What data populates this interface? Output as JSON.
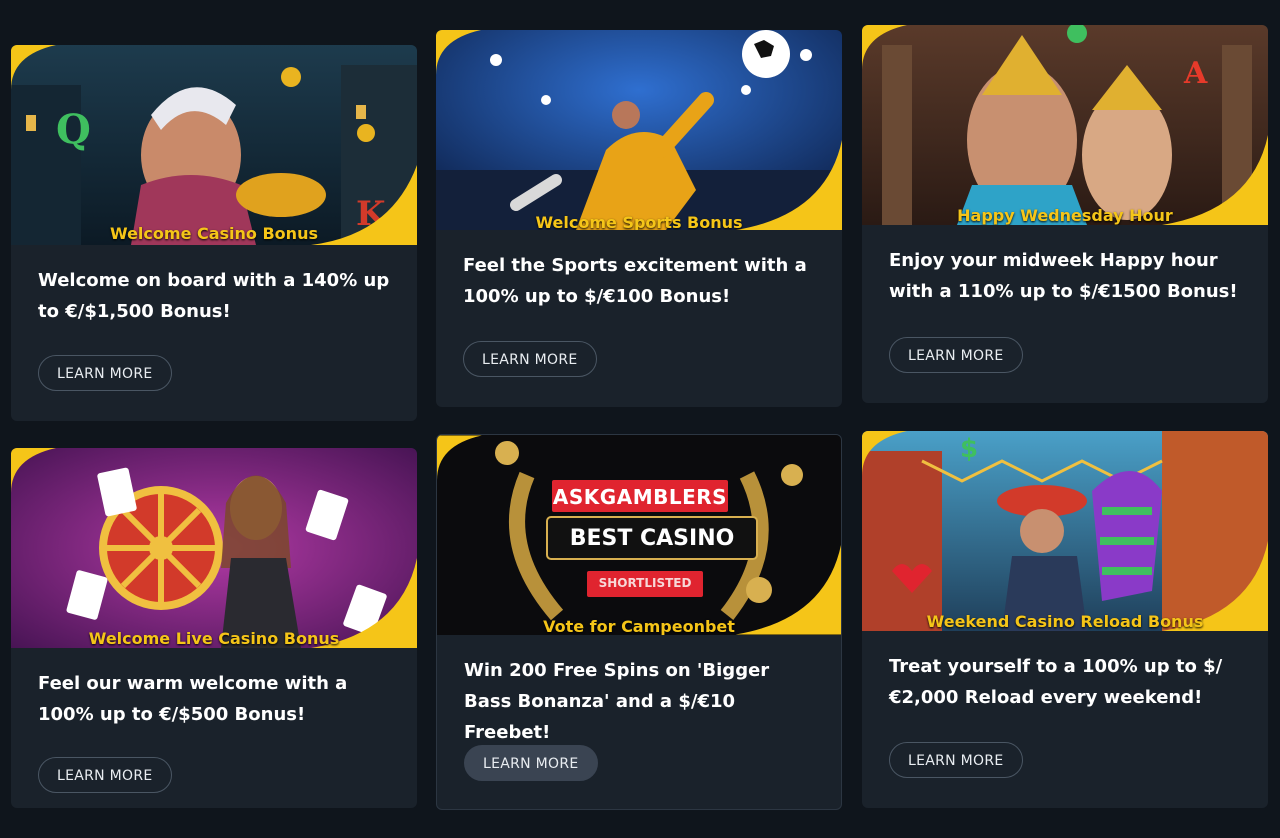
{
  "colors": {
    "page_bg": "#0f151c",
    "card_bg": "#1a222b",
    "accent": "#f5c518",
    "button_border": "#4a5663",
    "button_active_bg": "#3a4452"
  },
  "cards": [
    {
      "caption": "Welcome Casino Bonus",
      "description": "Welcome on board with a 140% up to €/$1,500 Bonus!",
      "button": "LEARN MORE",
      "art": "casino-wizard-coins"
    },
    {
      "caption": "Welcome Sports Bonus",
      "description": "Feel the Sports excitement with a 100% up to $/€100 Bonus!",
      "button": "LEARN MORE",
      "art": "football-player-stadium"
    },
    {
      "caption": "Happy Wednesday Hour",
      "description": "Enjoy your midweek Happy hour with a 110% up to $/€1500 Bonus!",
      "button": "LEARN MORE",
      "art": "egyptian-queens"
    },
    {
      "caption": "Welcome Live Casino Bonus",
      "description": "Feel our warm welcome with a 100% up to €/$500 Bonus!",
      "button": "LEARN MORE",
      "art": "roulette-wheel-dealer"
    },
    {
      "caption": "Vote for Campeonbet",
      "description": "Win 200 Free Spins on 'Bigger Bass Bonanza' and a $/€10 Freebet!",
      "button": "LEARN MORE",
      "art": "askgamblers-award",
      "award": {
        "brand": "ASKGAMBLERS",
        "title": "BEST CASINO",
        "tag": "SHORTLISTED"
      }
    },
    {
      "caption": "Weekend Casino Reload Bonus",
      "description": "Treat yourself to a 100% up to $/€2,000 Reload every weekend!",
      "button": "LEARN MORE",
      "art": "mariachi-pinata"
    }
  ]
}
